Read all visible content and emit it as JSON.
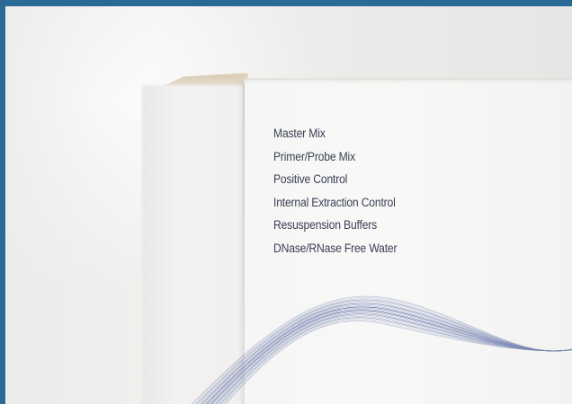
{
  "image": {
    "subject": "product-box-photo",
    "colors": {
      "frame": "#2a6a96",
      "text": "#3b3f55",
      "wave_dark": "#3a4a8c",
      "wave_light": "#9aa6c8"
    }
  },
  "box": {
    "contents": [
      "Master Mix",
      "Primer/Probe Mix",
      "Positive Control",
      "Internal Extraction Control",
      "Resuspension Buffers",
      "DNase/RNase Free Water"
    ]
  }
}
